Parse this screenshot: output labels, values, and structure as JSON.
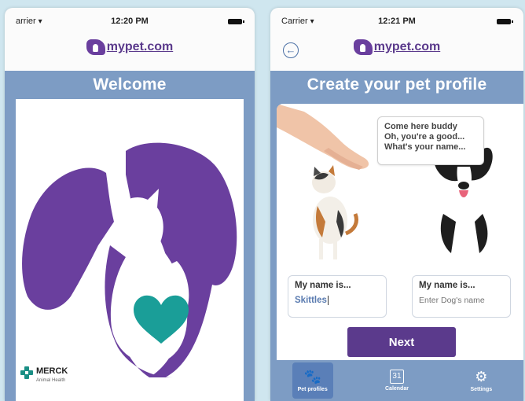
{
  "left_screen": {
    "status": {
      "carrier": "arrier",
      "time": "12:20 PM"
    },
    "logo_text": "mypet.com",
    "title": "Welcome",
    "sponsor": {
      "name": "MERCK",
      "subtitle": "Animal Health"
    },
    "colors": {
      "brand_purple": "#6a3f9e",
      "accent_teal": "#1a9e98",
      "band_blue": "#7d9cc4"
    }
  },
  "right_screen": {
    "status": {
      "carrier": "Carrier",
      "time": "12:21 PM"
    },
    "logo_text": "mypet.com",
    "title": "Create your pet profile",
    "speech": [
      "Come here buddy",
      "Oh, you're a good...",
      "What's your name..."
    ],
    "cat_card": {
      "label": "My name is...",
      "value": "Skittles"
    },
    "dog_card": {
      "label": "My name is...",
      "placeholder": "Enter Dog's name"
    },
    "next_label": "Next",
    "tabs": [
      {
        "label": "Pet profiles",
        "icon": "pet-profile-icon",
        "active": true
      },
      {
        "label": "Calendar",
        "icon": "calendar-icon",
        "day": "31",
        "active": false
      },
      {
        "label": "Settings",
        "icon": "gear-icon",
        "active": false
      }
    ]
  }
}
